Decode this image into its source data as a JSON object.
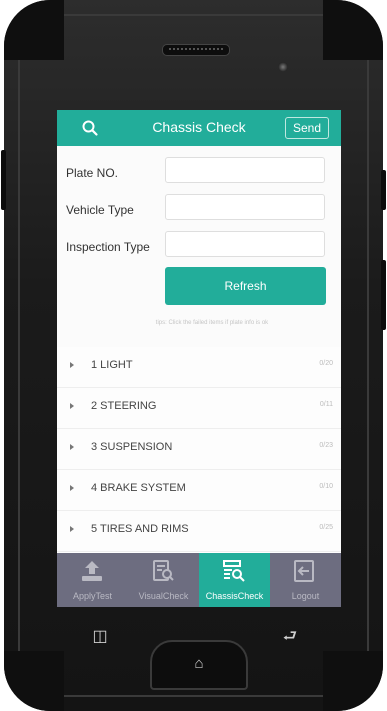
{
  "header": {
    "title": "Chassis Check",
    "send_label": "Send",
    "search_icon": "search-icon"
  },
  "form": {
    "plate_label": "Plate  NO.",
    "plate_value": "",
    "vehicle_type_label": "Vehicle Type",
    "vehicle_type_value": "",
    "inspection_type_label": "Inspection Type",
    "inspection_type_value": "",
    "refresh_label": "Refresh",
    "tip": "tips: Click the failed items if plate info is ok"
  },
  "checklist": [
    {
      "label": "1  LIGHT",
      "count": "0/20"
    },
    {
      "label": "2  STEERING",
      "count": "0/11"
    },
    {
      "label": "3  SUSPENSION",
      "count": "0/23"
    },
    {
      "label": "4  BRAKE SYSTEM",
      "count": "0/10"
    },
    {
      "label": "5  TIRES AND RIMS",
      "count": "0/25"
    }
  ],
  "tabs": [
    {
      "label": "ApplyTest",
      "icon": "upload-icon"
    },
    {
      "label": "VisualCheck",
      "icon": "document-search-icon"
    },
    {
      "label": "ChassisCheck",
      "icon": "list-search-icon",
      "active": true
    },
    {
      "label": "Logout",
      "icon": "logout-icon"
    }
  ],
  "colors": {
    "accent": "#22ad9a",
    "tabbar": "#6d6d80"
  }
}
